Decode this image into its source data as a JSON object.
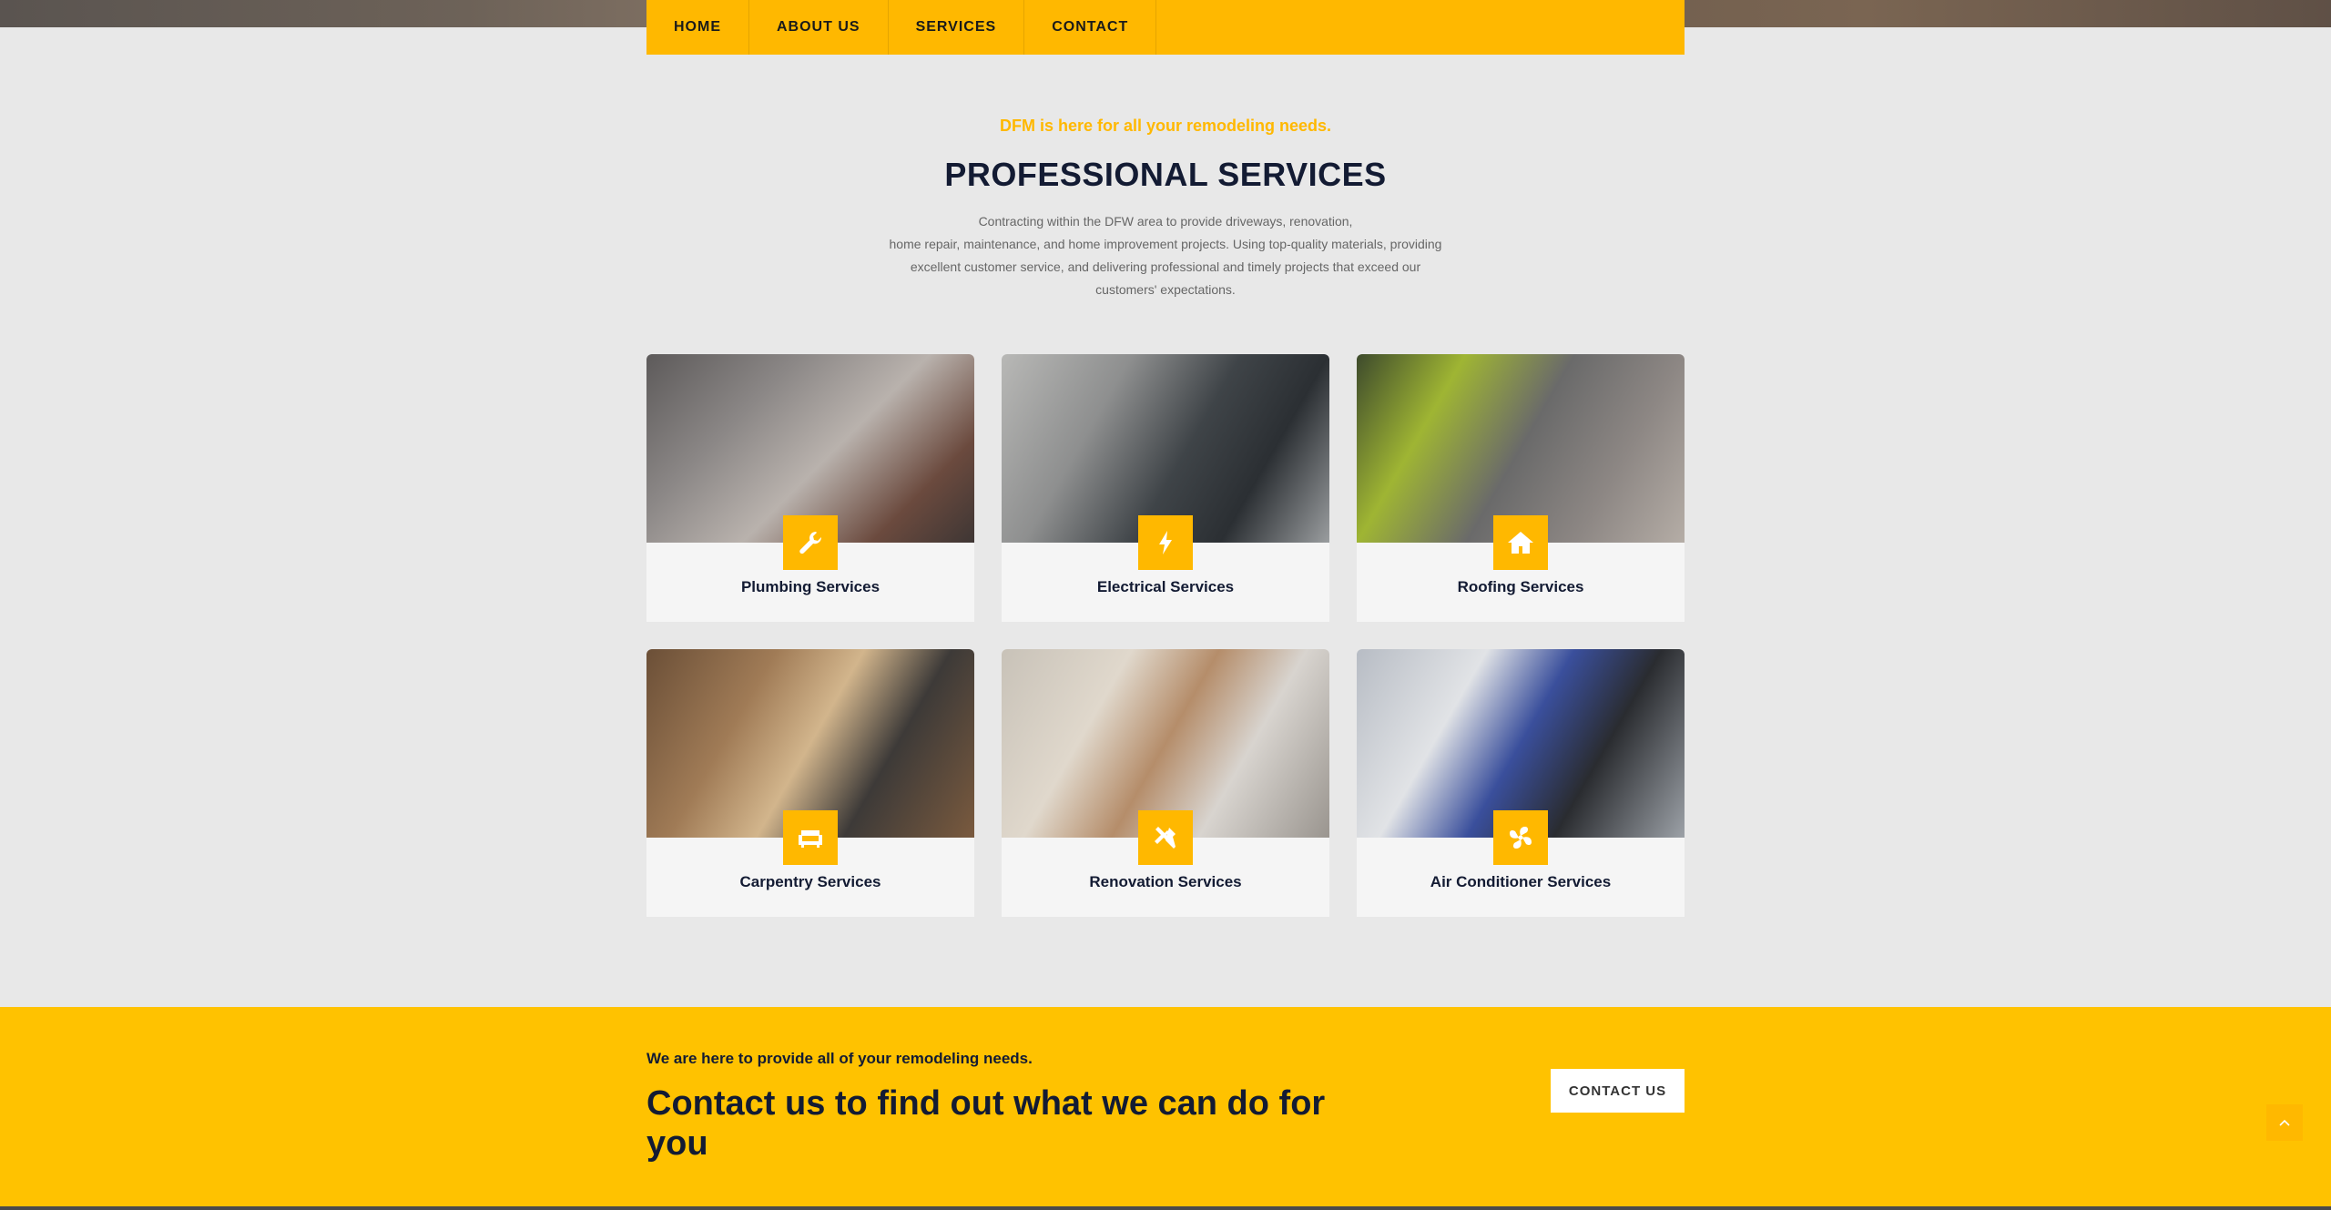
{
  "nav": {
    "items": [
      {
        "label": "HOME"
      },
      {
        "label": "ABOUT US"
      },
      {
        "label": "SERVICES"
      },
      {
        "label": "CONTACT"
      }
    ]
  },
  "intro": {
    "tagline": "DFM is here for all your remodeling needs.",
    "title": "PROFESSIONAL SERVICES",
    "text_lines": [
      "Contracting within the DFW area to provide driveways, renovation,",
      "home repair, maintenance, and home improvement projects. Using top-quality materials, providing",
      "excellent customer service, and delivering professional and timely projects that exceed our",
      "customers' expectations."
    ]
  },
  "services": [
    {
      "label": "Plumbing Services",
      "icon": "wrench-icon"
    },
    {
      "label": "Electrical Services",
      "icon": "lightning-icon"
    },
    {
      "label": "Roofing Services",
      "icon": "house-icon"
    },
    {
      "label": "Carpentry Services",
      "icon": "couch-icon"
    },
    {
      "label": "Renovation Services",
      "icon": "tools-icon"
    },
    {
      "label": "Air Conditioner Services",
      "icon": "fan-icon"
    }
  ],
  "cta": {
    "subtitle": "We are here to provide all of your remodeling needs.",
    "title": "Contact us to find out what we can do for you",
    "button_label": "CONTACT US"
  },
  "colors": {
    "accent": "#ffb800",
    "cta_background": "#ffc200",
    "heading": "#131b33"
  }
}
